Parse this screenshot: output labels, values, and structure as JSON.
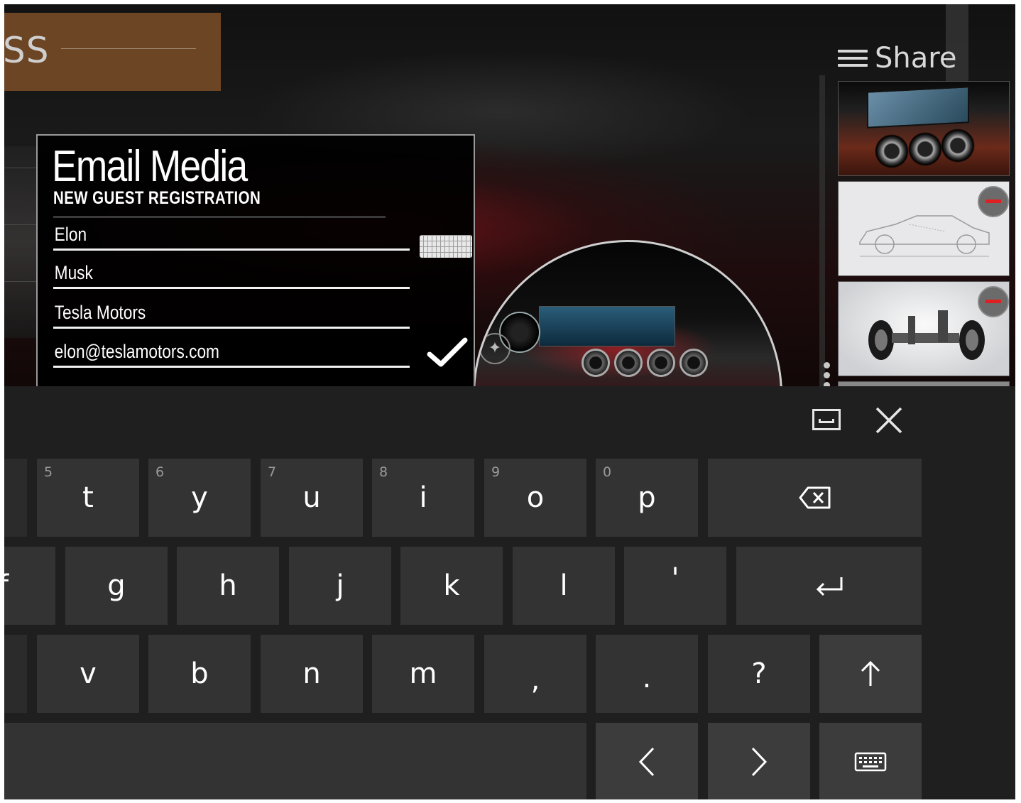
{
  "background_app": {
    "brand_text": "SS",
    "share_label": "Share"
  },
  "dialog": {
    "title": "Email Media",
    "subtitle": "NEW GUEST REGISTRATION",
    "fields": [
      {
        "name": "first-name-field",
        "value": "Elon"
      },
      {
        "name": "last-name-field",
        "value": "Musk"
      },
      {
        "name": "company-field",
        "value": "Tesla Motors"
      },
      {
        "name": "email-field",
        "value": "elon@teslamotors.com"
      }
    ]
  },
  "keyboard": {
    "row1": [
      {
        "label": "t",
        "hint": "5"
      },
      {
        "label": "y",
        "hint": "6"
      },
      {
        "label": "u",
        "hint": "7"
      },
      {
        "label": "i",
        "hint": "8"
      },
      {
        "label": "o",
        "hint": "9"
      },
      {
        "label": "p",
        "hint": "0"
      }
    ],
    "row2": [
      "f",
      "g",
      "h",
      "j",
      "k",
      "l",
      "'"
    ],
    "row3": [
      "v",
      "b",
      "n",
      "m",
      ",",
      ".",
      "?"
    ],
    "icons": {
      "backspace": "backspace-icon",
      "enter": "enter-icon",
      "shift": "shift-up-arrow-icon",
      "left": "chevron-left-icon",
      "right": "chevron-right-icon",
      "layout": "keyboard-layout-icon",
      "dock": "dock-icon",
      "close": "close-icon"
    }
  },
  "colors": {
    "key": "#333333",
    "keyboard_bg": "#1f1f1f",
    "brand_tile": "#6c4524",
    "remove_red": "#e02020"
  }
}
